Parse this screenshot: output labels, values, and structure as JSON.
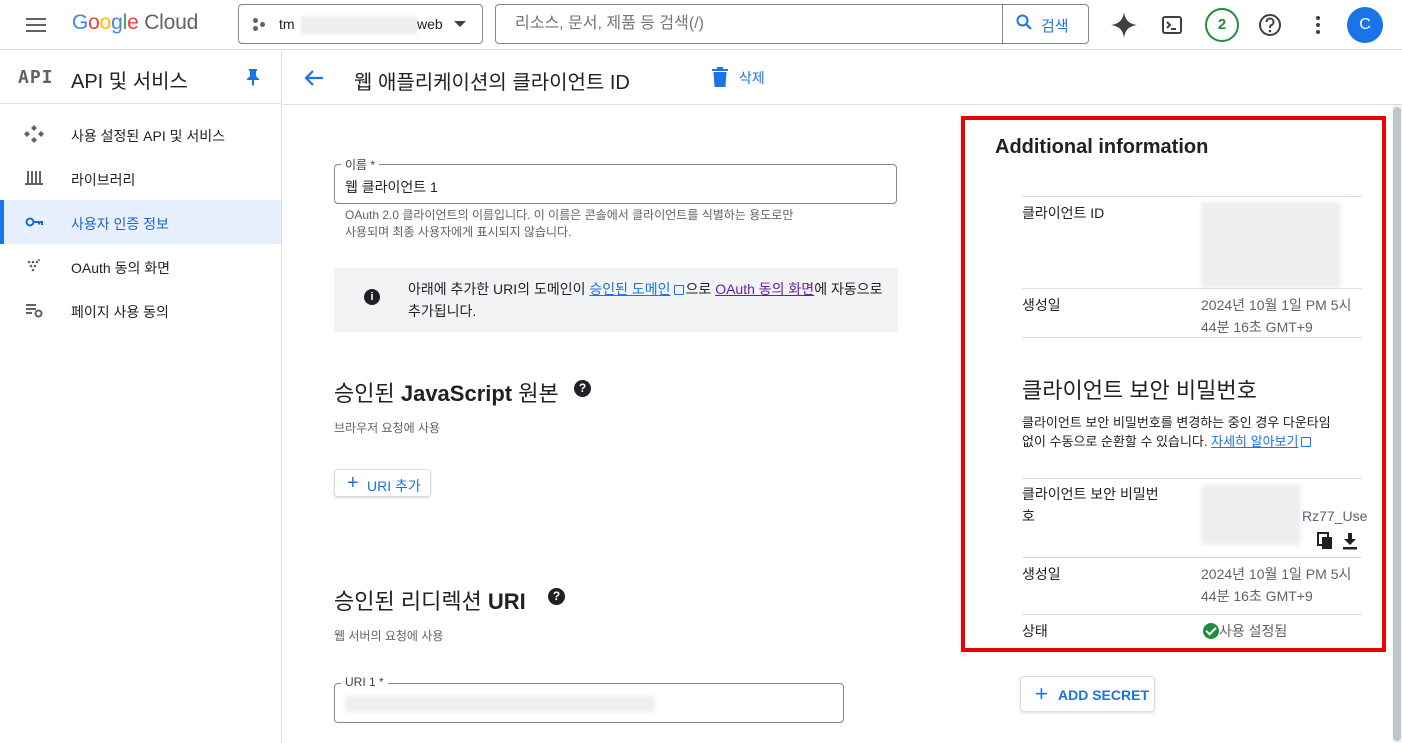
{
  "header": {
    "logo_google": [
      "G",
      "o",
      "o",
      "g",
      "l",
      "e"
    ],
    "logo_cloud": "Cloud",
    "project_prefix": "tm",
    "project_suffix": "web",
    "search_placeholder": "리소스, 문서, 제품 등 검색(/)",
    "search_button": "검색",
    "notification_count": "2",
    "avatar_letter": "C"
  },
  "sidebar": {
    "api_logo": "API",
    "title": "API 및 서비스",
    "items": [
      {
        "label": "사용 설정된 API 및 서비스",
        "icon": "apis-icon"
      },
      {
        "label": "라이브러리",
        "icon": "library-icon"
      },
      {
        "label": "사용자 인증 정보",
        "icon": "key-icon",
        "active": true
      },
      {
        "label": "OAuth 동의 화면",
        "icon": "oauth-consent-icon"
      },
      {
        "label": "페이지 사용 동의",
        "icon": "page-usage-icon"
      }
    ]
  },
  "page": {
    "title": "웹 애플리케이션의 클라이언트 ID",
    "delete_label": "삭제"
  },
  "form": {
    "name_label": "이름 *",
    "name_value": "웹 클라이언트 1",
    "name_hint_1": "OAuth 2.0 클라이언트의 이름입니다. 이 이름은 콘솔에서 클라이언트를 식별하는 용도로만",
    "name_hint_2": "사용되며 최종 사용자에게 표시되지 않습니다.",
    "note_prefix": "아래에 추가한 URI의 도메인이 ",
    "note_link1": "승인된 도메인",
    "note_mid": "으로 ",
    "note_link2": "OAuth 동의 화면",
    "note_suffix": "에 자동으로 추가됩니다.",
    "js_origins_title_pre": "승인된 ",
    "js_origins_title_bold": "JavaScript",
    "js_origins_title_post": " 원본",
    "js_origins_hint": "브라우저 요청에 사용",
    "add_uri_label": "URI 추가",
    "redirect_title_pre": "승인된 리디렉션 ",
    "redirect_title_bold": "URI",
    "redirect_hint": "웹 서버의 요청에 사용",
    "uri1_label": "URI 1 *"
  },
  "additional": {
    "title": "Additional information",
    "client_id_label": "클라이언트 ID",
    "created_label": "생성일",
    "created_value_1": "2024년 10월 1일 PM 5시",
    "created_value_2": "44분 16초 GMT+9",
    "secret_heading": "클라이언트 보안 비밀번호",
    "secret_desc_1": "클라이언트 보안 비밀번호를 변경하는 중인 경우 다운타임",
    "secret_desc_2": "없이 수동으로 순환할 수 있습니다. ",
    "secret_desc_link": "자세히 알아보기",
    "secret_label_1": "클라이언트 보안 비밀번",
    "secret_label_2": "호",
    "secret_partial": "Rz77_Use",
    "secret_created_label": "생성일",
    "secret_created_1": "2024년 10월 1일 PM 5시",
    "secret_created_2": "44분 16초 GMT+9",
    "status_label": "상태",
    "status_value": "사용 설정됨",
    "add_secret_label": "ADD SECRET"
  },
  "colors": {
    "accent": "#1a73e8",
    "highlight_border": "#ee0000",
    "enabled_green": "#1e8e3e"
  }
}
